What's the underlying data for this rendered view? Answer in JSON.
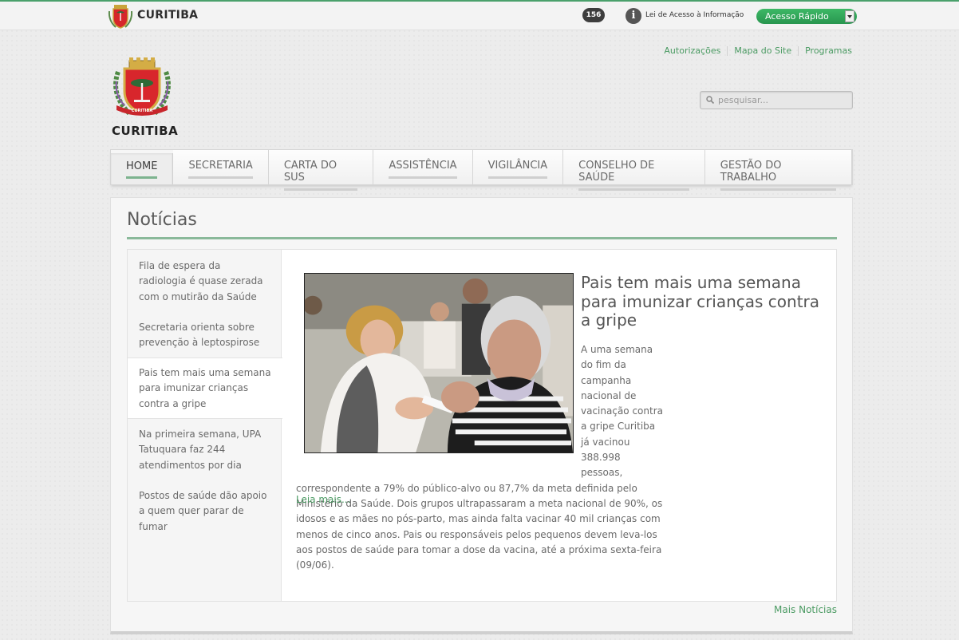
{
  "topbar": {
    "brand": "CURITIBA",
    "phone_badge": "156",
    "info_link": "Lei de Acesso à Informação",
    "quick_access": "Acesso Rápido"
  },
  "header": {
    "util_links": [
      "Autorizações",
      "Mapa do Site",
      "Programas"
    ],
    "brand": "CURITIBA",
    "search_placeholder": "pesquisar..."
  },
  "nav": {
    "items": [
      "HOME",
      "SECRETARIA",
      "CARTA DO SUS",
      "ASSISTÊNCIA",
      "VIGILÂNCIA",
      "CONSELHO DE SAÚDE",
      "GESTÃO DO TRABALHO"
    ],
    "active": "HOME"
  },
  "news": {
    "section_title": "Notícias",
    "list": [
      "Fila de espera da radiologia é quase zerada com o mutirão da Saúde",
      "Secretaria orienta sobre prevenção à leptospirose",
      "Pais tem mais uma semana para imunizar crianças contra a gripe",
      "Na primeira semana, UPA Tatuquara faz 244 atendimentos por dia",
      "Postos de saúde dão apoio a quem quer parar de fumar"
    ],
    "active_index": 2,
    "feature": {
      "title": "Pais tem mais uma semana para imunizar crianças contra a gripe",
      "body": "A uma semana do fim da campanha nacional de vacinação contra a gripe Curitiba já vacinou 388.998 pessoas, correspondente a 79% do público-alvo ou 87,7% da meta definida pelo Ministério da Saúde. Dois grupos ultrapassaram a meta nacional de 90%, os idosos e as mães no pós-parto, mas ainda falta vacinar 40 mil crianças com menos de cinco anos. Pais ou responsáveis pelos pequenos devem leva-los aos postos de saúde para tomar a dose da vacina, até a próxima sexta-feira (09/06).",
      "read_more": "Leia mais..."
    },
    "more_news": "Mais Notícias"
  },
  "colors": {
    "accent_green": "#4a9a62",
    "quick_access_green": "#2fa85a",
    "rule_green": "#8ab99a"
  }
}
